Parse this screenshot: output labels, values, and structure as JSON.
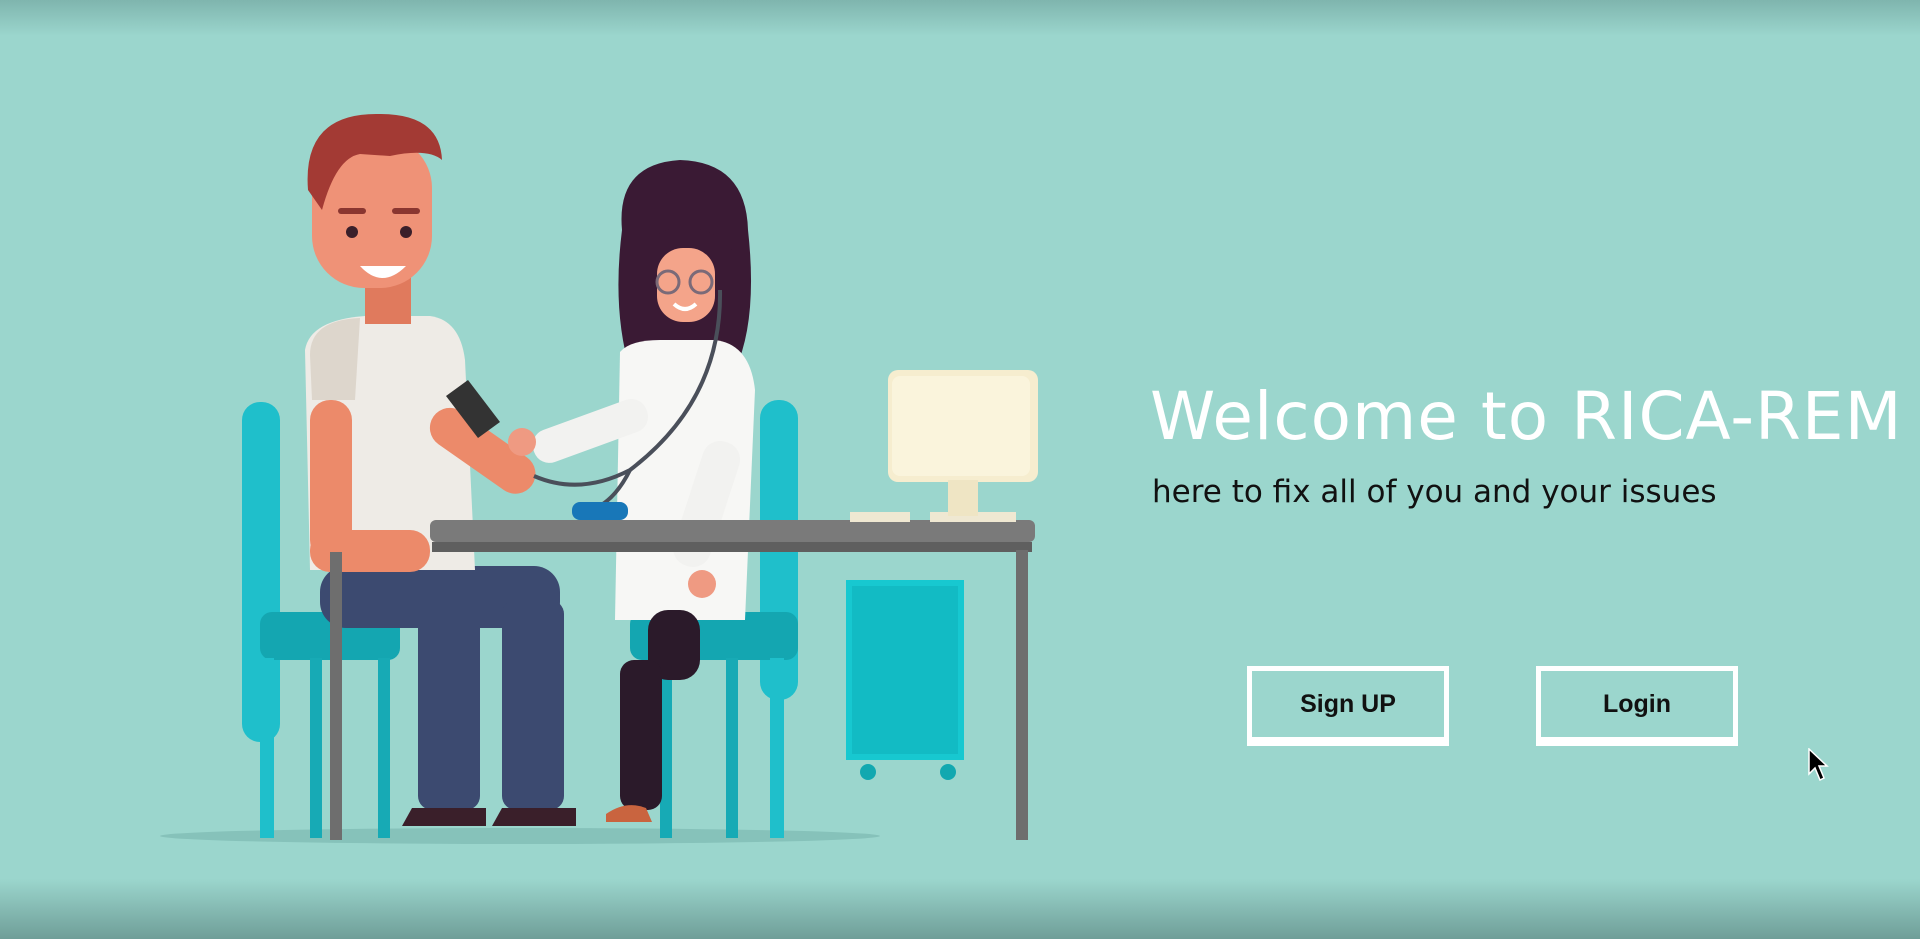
{
  "hero": {
    "title": "Welcome to RICA-REM",
    "subtitle": "here to fix all of you and your issues"
  },
  "actions": {
    "signup_label": "Sign UP",
    "login_label": "Login"
  },
  "colors": {
    "background": "#9bd6cd",
    "title": "#ffffff",
    "button_border": "#ffffff",
    "chair": "#1fbfcb",
    "desk": "#6e6e6e"
  }
}
